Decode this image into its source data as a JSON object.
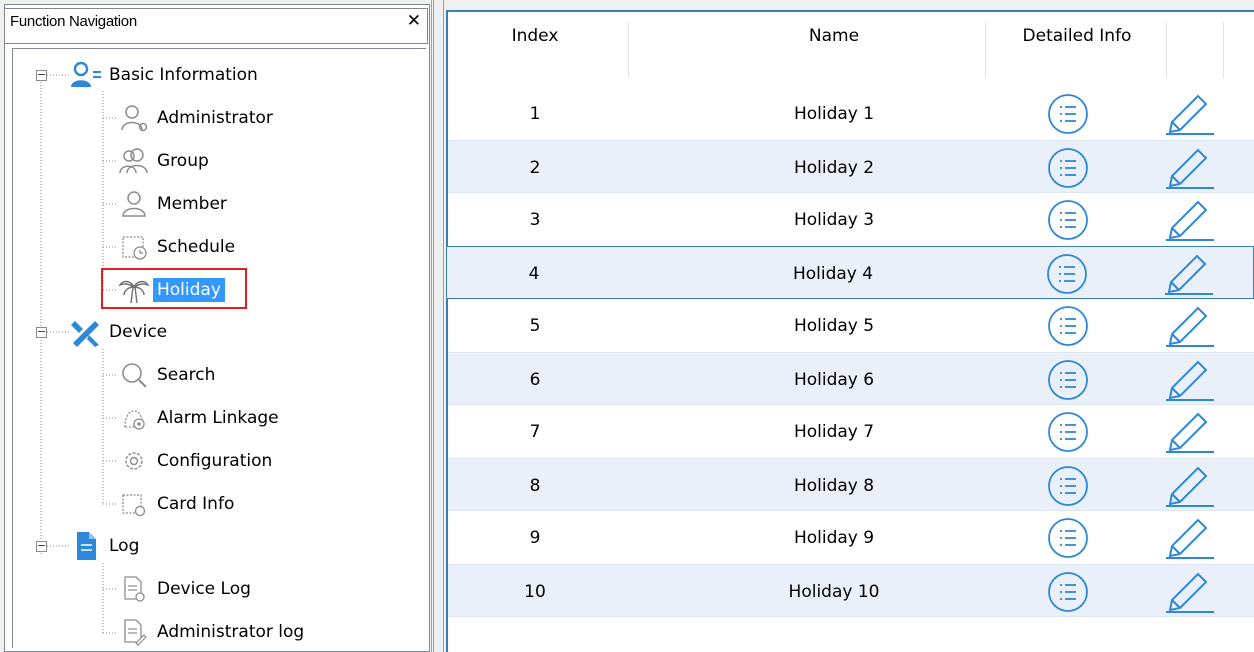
{
  "nav": {
    "title": "Function Navigation",
    "close": "✕",
    "items": [
      {
        "label": "Basic Information",
        "icon": "user-group-icon",
        "level": 0
      },
      {
        "label": "Administrator",
        "icon": "administrator-icon",
        "level": 1
      },
      {
        "label": "Group",
        "icon": "group-icon",
        "level": 1
      },
      {
        "label": "Member",
        "icon": "member-icon",
        "level": 1
      },
      {
        "label": "Schedule",
        "icon": "schedule-icon",
        "level": 1
      },
      {
        "label": "Holiday",
        "icon": "palm-tree-icon",
        "level": 1,
        "selected": true
      },
      {
        "label": "Device",
        "icon": "tools-icon",
        "level": 0
      },
      {
        "label": "Search",
        "icon": "search-icon",
        "level": 1
      },
      {
        "label": "Alarm Linkage",
        "icon": "alarm-linkage-icon",
        "level": 1
      },
      {
        "label": "Configuration",
        "icon": "gear-icon",
        "level": 1
      },
      {
        "label": "Card Info",
        "icon": "card-info-icon",
        "level": 1
      },
      {
        "label": "Log",
        "icon": "document-icon",
        "level": 0
      },
      {
        "label": "Device Log",
        "icon": "device-log-icon",
        "level": 1
      },
      {
        "label": "Administrator log",
        "icon": "administrator-log-icon",
        "level": 1
      }
    ]
  },
  "grid": {
    "columns": [
      "Index",
      "Name",
      "Detailed Info",
      ""
    ],
    "rows": [
      {
        "index": "1",
        "name": "Holiday 1"
      },
      {
        "index": "2",
        "name": "Holiday 2"
      },
      {
        "index": "3",
        "name": "Holiday 3"
      },
      {
        "index": "4",
        "name": "Holiday 4"
      },
      {
        "index": "5",
        "name": "Holiday 5"
      },
      {
        "index": "6",
        "name": "Holiday 6"
      },
      {
        "index": "7",
        "name": "Holiday 7"
      },
      {
        "index": "8",
        "name": "Holiday 8"
      },
      {
        "index": "9",
        "name": "Holiday 9"
      },
      {
        "index": "10",
        "name": "Holiday 10"
      }
    ],
    "focused_row": 3
  },
  "colors": {
    "accent": "#3399ff",
    "icon_blue": "#2f87d8",
    "selection_border": "#e02020",
    "row_alt": "#eaf0fa"
  }
}
